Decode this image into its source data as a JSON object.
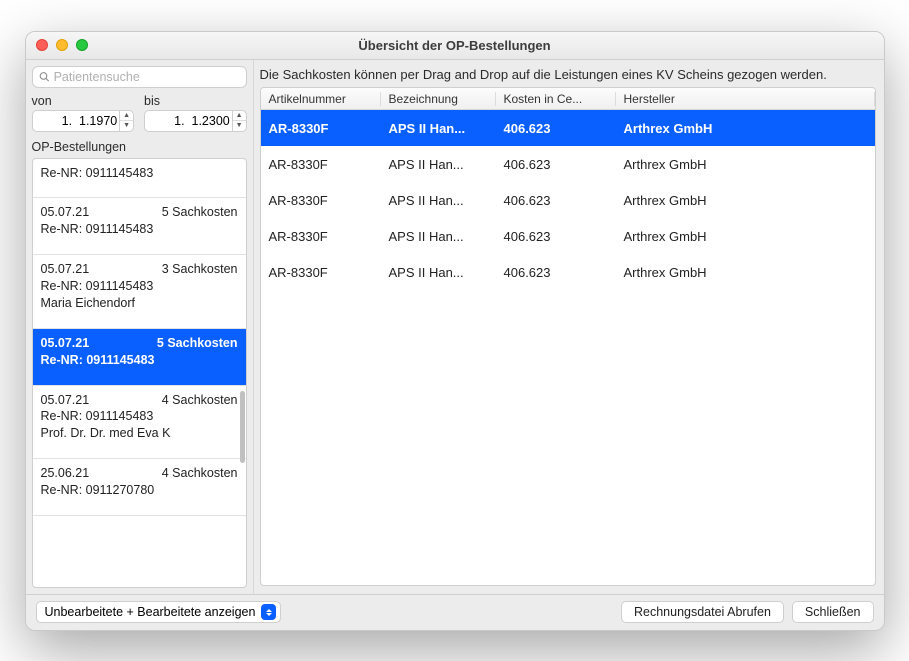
{
  "window": {
    "title": "Übersicht der OP-Bestellungen"
  },
  "sidebar": {
    "search_placeholder": "Patientensuche",
    "von_label": "von",
    "bis_label": "bis",
    "von_value": "1.  1.1970",
    "bis_value": "1.  1.2300",
    "orders_label": "OP-Bestellungen",
    "orders": [
      {
        "date": "",
        "cost": "",
        "re": "Re-NR: 0911145483",
        "patient": "",
        "selected": false
      },
      {
        "date": "05.07.21",
        "cost": "5 Sachkosten",
        "re": "Re-NR: 0911145483",
        "patient": "",
        "selected": false
      },
      {
        "date": "05.07.21",
        "cost": "3 Sachkosten",
        "re": "Re-NR: 0911145483",
        "patient": "Maria Eichendorf",
        "selected": false
      },
      {
        "date": "05.07.21",
        "cost": "5 Sachkosten",
        "re": "Re-NR: 0911145483",
        "patient": "",
        "selected": true
      },
      {
        "date": "05.07.21",
        "cost": "4 Sachkosten",
        "re": "Re-NR: 0911145483",
        "patient": "Prof. Dr. Dr. med Eva K",
        "selected": false
      },
      {
        "date": "25.06.21",
        "cost": "4 Sachkosten",
        "re": "Re-NR: 0911270780",
        "patient": "",
        "selected": false
      }
    ]
  },
  "main": {
    "instructions": "Die Sachkosten können per Drag and Drop auf die Leistungen eines KV Scheins gezogen werden.",
    "columns": {
      "c1": "Artikelnummer",
      "c2": "Bezeichnung",
      "c3": "Kosten in Ce...",
      "c4": "Hersteller"
    },
    "rows": [
      {
        "artnr": "AR-8330F",
        "bez": "APS II Han...",
        "kosten": "406.623",
        "hersteller": "Arthrex GmbH",
        "selected": true
      },
      {
        "artnr": "AR-8330F",
        "bez": "APS II Han...",
        "kosten": "406.623",
        "hersteller": "Arthrex GmbH",
        "selected": false
      },
      {
        "artnr": "AR-8330F",
        "bez": "APS II Han...",
        "kosten": "406.623",
        "hersteller": "Arthrex GmbH",
        "selected": false
      },
      {
        "artnr": "AR-8330F",
        "bez": "APS II Han...",
        "kosten": "406.623",
        "hersteller": "Arthrex GmbH",
        "selected": false
      },
      {
        "artnr": "AR-8330F",
        "bez": "APS II Han...",
        "kosten": "406.623",
        "hersteller": "Arthrex GmbH",
        "selected": false
      }
    ]
  },
  "footer": {
    "filter_label": "Unbearbeitete + Bearbeitete anzeigen",
    "fetch_label": "Rechnungsdatei Abrufen",
    "close_label": "Schließen"
  }
}
